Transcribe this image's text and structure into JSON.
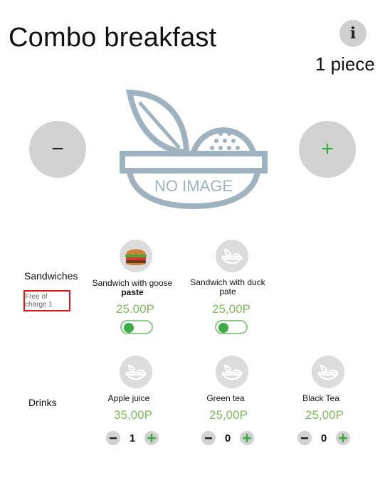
{
  "header": {
    "title": "Combo breakfast",
    "info_label": "i",
    "quantity_text": "1 piece"
  },
  "hero": {
    "minus_label": "−",
    "plus_label": "+",
    "placeholder_text": "NO IMAGE"
  },
  "sandwiches": {
    "label": "Sandwiches",
    "note": "Free of charge 1",
    "items": [
      {
        "name_line1": "Sandwich with goose",
        "name_line2": "paste",
        "price": "25.00P",
        "toggle_on": true,
        "icon": "burger-icon"
      },
      {
        "name_line1": "Sandwich with duck",
        "name_line2": "pate",
        "price": "25,00P",
        "toggle_on": true,
        "icon": "salad-bowl-icon"
      }
    ]
  },
  "drinks": {
    "label": "Drinks",
    "items": [
      {
        "name": "Apple juice",
        "price": "35,00P",
        "quantity": "1",
        "icon": "salad-bowl-icon"
      },
      {
        "name": "Green tea",
        "price": "25,00P",
        "quantity": "0",
        "icon": "salad-bowl-icon"
      },
      {
        "name": "Black Tea",
        "price": "25,00P",
        "quantity": "0",
        "icon": "salad-bowl-icon"
      }
    ]
  },
  "colors": {
    "accent_green": "#3cab45",
    "price_green": "#7dbd5a",
    "highlight_red": "#e0151b",
    "button_gray": "#d2d2d2"
  }
}
